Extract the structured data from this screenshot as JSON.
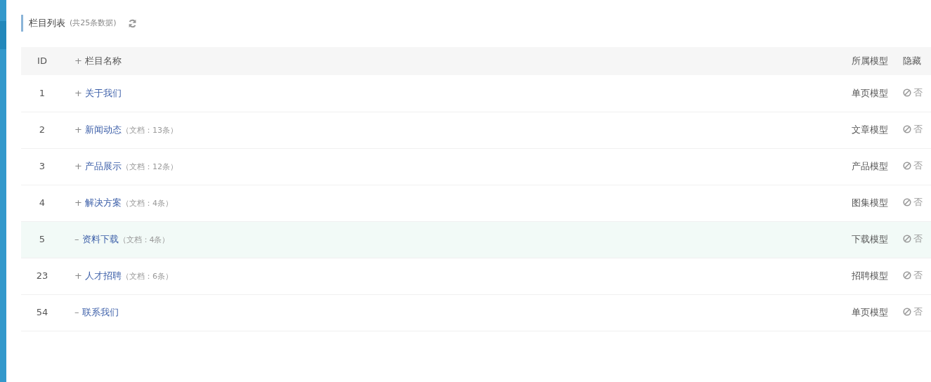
{
  "panel": {
    "title": "栏目列表",
    "count_note": "(共25条数据)"
  },
  "table": {
    "columns": [
      {
        "label": "ID"
      },
      {
        "toggle": "+",
        "label": "栏目名称"
      },
      {
        "label": "所属模型"
      },
      {
        "label": "隐藏"
      }
    ],
    "rows": [
      {
        "id": "1",
        "toggle": "+",
        "name": "关于我们",
        "model": "单页模型",
        "hidden": "否",
        "selected": false
      },
      {
        "id": "2",
        "toggle": "+",
        "name": "新闻动态",
        "docs": "（文档：13条）",
        "model": "文章模型",
        "hidden": "否",
        "selected": false
      },
      {
        "id": "3",
        "toggle": "+",
        "name": "产品展示",
        "docs": "（文档：12条）",
        "model": "产品模型",
        "hidden": "否",
        "selected": false
      },
      {
        "id": "4",
        "toggle": "+",
        "name": "解决方案",
        "docs": "（文档：4条）",
        "model": "图集模型",
        "hidden": "否",
        "selected": false
      },
      {
        "id": "5",
        "toggle": "–",
        "name": "资料下载",
        "docs": "（文档：4条）",
        "model": "下载模型",
        "hidden": "否",
        "selected": true
      },
      {
        "id": "23",
        "toggle": "+",
        "name": "人才招聘",
        "docs": "（文档：6条）",
        "model": "招聘模型",
        "hidden": "否",
        "selected": false
      },
      {
        "id": "54",
        "toggle": "–",
        "name": "联系我们",
        "model": "单页模型",
        "hidden": "否",
        "selected": false
      }
    ]
  }
}
